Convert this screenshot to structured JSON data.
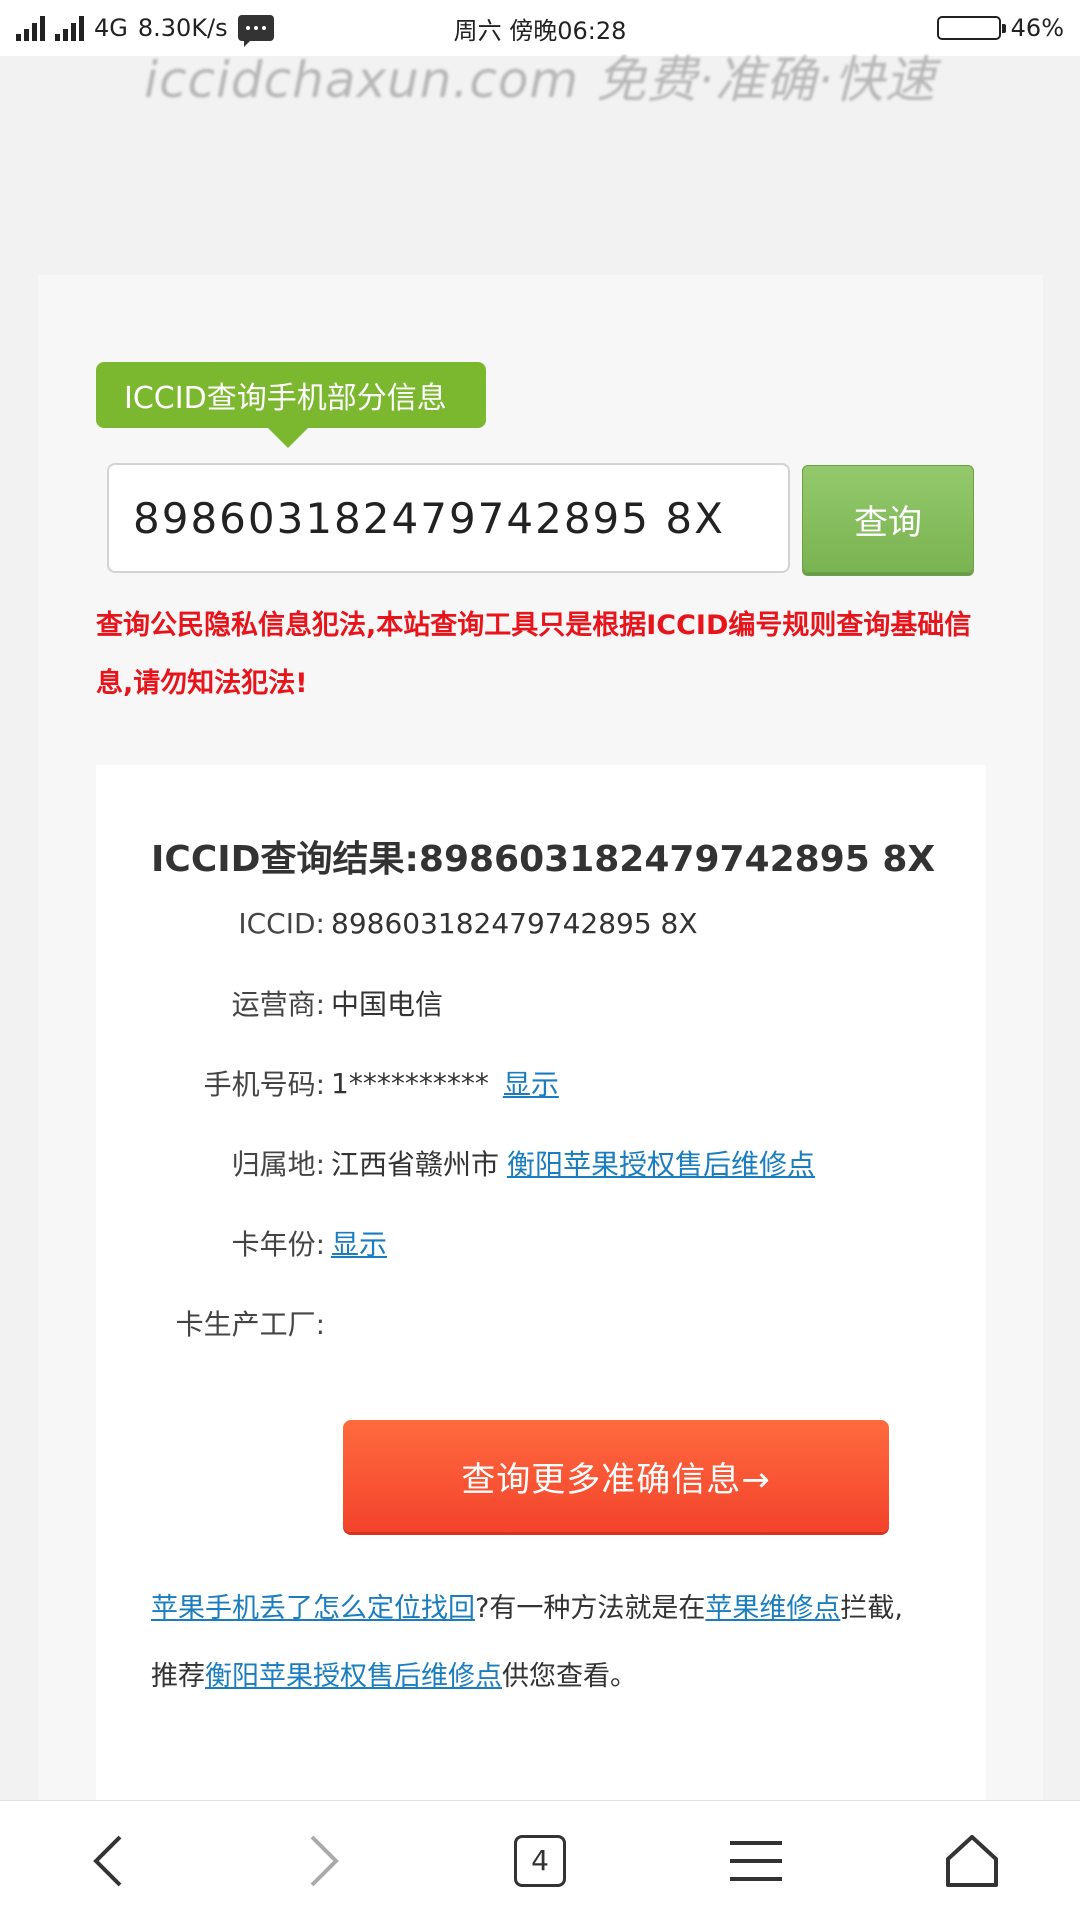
{
  "status_bar": {
    "network": "4G",
    "speed": "8.30K/s",
    "time": "周六 傍晚06:28",
    "battery_percent": "46%",
    "battery_level": 0.46
  },
  "header": {
    "slogan": "iccidchaxun.com 免费·准确·快速"
  },
  "search": {
    "tag_label": "ICCID查询手机部分信息",
    "input_value": "898603182479742895 8X",
    "button_label": "查询"
  },
  "warning": "查询公民隐私信息犯法,本站查询工具只是根据ICCID编号规则查询基础信息,请勿知法犯法!",
  "result": {
    "title": "ICCID查询结果:898603182479742895 8X",
    "rows": [
      {
        "label": "ICCID:",
        "value": "898603182479742895 8X",
        "link": ""
      },
      {
        "label": "运营商:",
        "value": "中国电信",
        "link": ""
      },
      {
        "label": "手机号码:",
        "value": "1**********",
        "link": "显示"
      },
      {
        "label": "归属地:",
        "value": "江西省赣州市",
        "link": "衡阳苹果授权售后维修点"
      },
      {
        "label": "卡年份:",
        "value": "",
        "link": "显示"
      },
      {
        "label": "卡生产工厂:",
        "value": "",
        "link": ""
      }
    ],
    "more_button": "查询更多准确信息→",
    "promo": {
      "link1": "苹果手机丢了怎么定位找回",
      "text1": "?有一种方法就是在",
      "link2": "苹果维修点",
      "text2": "拦截,",
      "text3": "推荐",
      "link3": "衡阳苹果授权售后维修点",
      "text4": "供您查看。"
    }
  },
  "bottom_nav": {
    "tab_count": "4"
  }
}
